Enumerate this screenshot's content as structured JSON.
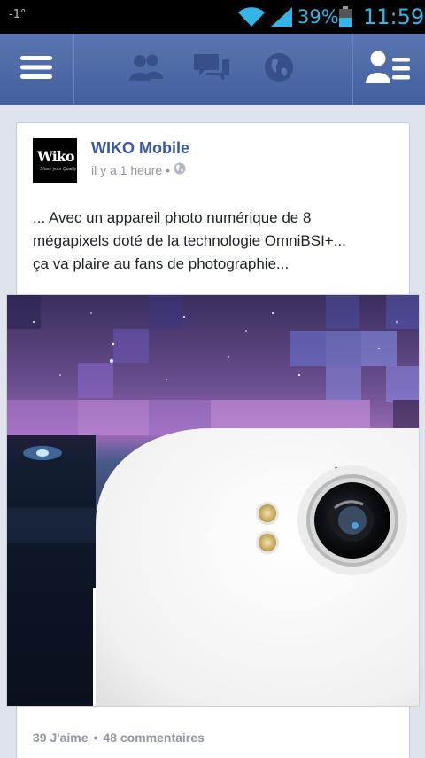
{
  "status": {
    "left_indicator": "-1°",
    "battery_percent": "39%",
    "time": "11:59"
  },
  "nav": {
    "menu_icon": "hamburger-menu-icon",
    "friends_icon": "friends-icon",
    "messages_icon": "messages-icon",
    "notifications_icon": "globe-icon",
    "friend_requests_icon": "friend-requests-icon"
  },
  "post": {
    "page_name": "WIKO Mobile",
    "avatar_logo": "Wiko",
    "avatar_tagline": "Share your Quality",
    "timestamp": "il y a 1 heure",
    "privacy_icon": "globe-icon",
    "text_lines": [
      "... Avec un appareil photo numérique de 8",
      "mégapixels doté de la technologie OmniBSI+...",
      "ça va plaire au fans de photographie..."
    ],
    "likes": "39 J'aime",
    "separator": "•",
    "comments": "48 commentaires"
  },
  "colors": {
    "facebook_blue": "#3b5998",
    "navbar": "#4c66a4",
    "status_accent": "#33b5e5"
  }
}
